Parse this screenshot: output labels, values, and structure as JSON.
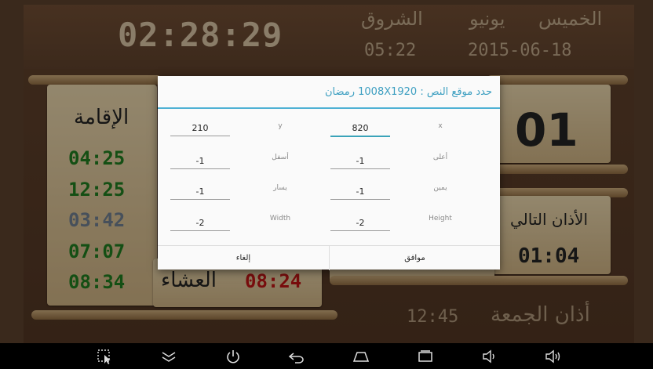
{
  "header": {
    "clock": "02:28:29",
    "day": "الخميس",
    "month": "يونيو",
    "date": "2015-06-18",
    "sunrise_label": "الشروق",
    "sunrise_time": "05:22"
  },
  "iqama": {
    "title": "الإقامة",
    "times": [
      {
        "value": "04:25",
        "color": "#1f7a1f"
      },
      {
        "value": "12:25",
        "color": "#1f7a1f"
      },
      {
        "value": "03:42",
        "color": "#6d7b8c"
      },
      {
        "value": "07:07",
        "color": "#1f7a1f"
      },
      {
        "value": "08:34",
        "color": "#1f7a1f"
      }
    ]
  },
  "isha": {
    "label": "العشاء",
    "time": "08:24"
  },
  "right_panel": {
    "big_number": "01",
    "next_adhan_label": "الأذان التالي",
    "next_adhan_time": "01:04"
  },
  "jumua": {
    "label": "أذان الجمعة",
    "time": "12:45"
  },
  "dialog": {
    "title": "حدد موقع النص : 1008X1920 رمضان",
    "fields": {
      "x": {
        "label": "x",
        "value": "820"
      },
      "y": {
        "label": "y",
        "value": "210"
      },
      "top": {
        "label": "أعلى",
        "value": "-1"
      },
      "bottom": {
        "label": "أسفل",
        "value": "-1"
      },
      "right": {
        "label": "يمين",
        "value": "-1"
      },
      "left": {
        "label": "يسار",
        "value": "-1"
      },
      "height": {
        "label": "Height",
        "value": "-2"
      },
      "width": {
        "label": "Width",
        "value": "-2"
      }
    },
    "ok_label": "موافق",
    "cancel_label": "إلغاء"
  },
  "navbar": {
    "icons": [
      "screenshot-icon",
      "collapse-icon",
      "power-icon",
      "back-icon",
      "home-icon",
      "recents-icon",
      "volume-down-icon",
      "volume-up-icon"
    ]
  },
  "colors": {
    "accent": "#3d9fc1",
    "isha_time": "#b81414",
    "parchment": "#e2cfa7",
    "background": "#5a3f2b"
  }
}
